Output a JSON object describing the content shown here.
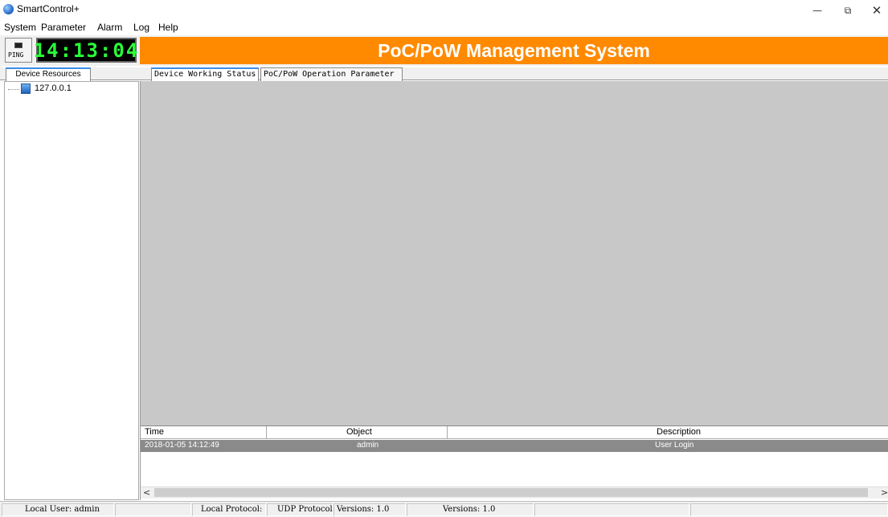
{
  "window": {
    "title": "SmartControl+",
    "icon": "globe-icon",
    "controls": {
      "minimize": "—",
      "restore": "⧉",
      "close": "✕"
    }
  },
  "menu": [
    "System",
    "Parameter",
    "Alarm",
    "Log",
    "Help"
  ],
  "toolbar": {
    "ping_label": "PING",
    "clock": "14:13:04",
    "banner": "PoC/PoW Management System",
    "banner_color": "#ff8a00"
  },
  "left_panel": {
    "tab": "Device Resources",
    "tree": [
      {
        "label": "127.0.0.1",
        "icon": "computer-icon"
      }
    ]
  },
  "main": {
    "tabs": [
      "Device Working Status",
      "PoC/PoW Operation Parameter"
    ],
    "active_tab": 0
  },
  "log": {
    "columns": [
      "Time",
      "Object",
      "Description"
    ],
    "rows": [
      {
        "time": "2018-01-05 14:12:49",
        "object": "admin",
        "description": "User Login"
      }
    ],
    "scroll_left": "<",
    "scroll_right": ">"
  },
  "status": {
    "user": "Local User: admin",
    "protocol_label": "Local Protocol:",
    "protocol": "UDP Protocol",
    "version1": "Versions: 1.0",
    "version2": "Versions: 1.0"
  }
}
